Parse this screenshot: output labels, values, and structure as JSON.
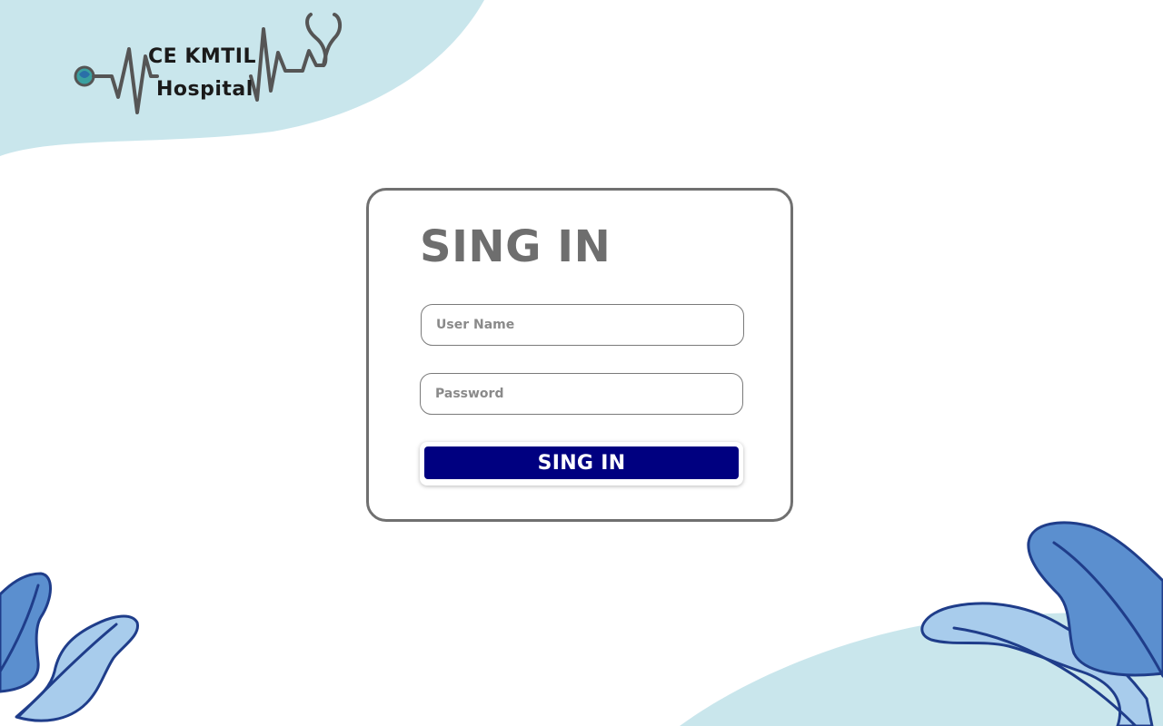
{
  "branding": {
    "name_line1": "CE KMTIL",
    "name_line2": "Hospital",
    "logo_icons": [
      "globe-icon",
      "heartbeat-line-icon",
      "stethoscope-icon"
    ]
  },
  "login": {
    "title": "SING IN",
    "username": {
      "placeholder": "User Name",
      "value": ""
    },
    "password": {
      "placeholder": "Password",
      "value": ""
    },
    "submit_label": "SING IN"
  },
  "colors": {
    "button": "#000080",
    "blob": "#c9e6ec",
    "leaf_dark": "#5b8fcf",
    "leaf_light": "#a8ccec",
    "leaf_outline": "#1f3d8a"
  }
}
